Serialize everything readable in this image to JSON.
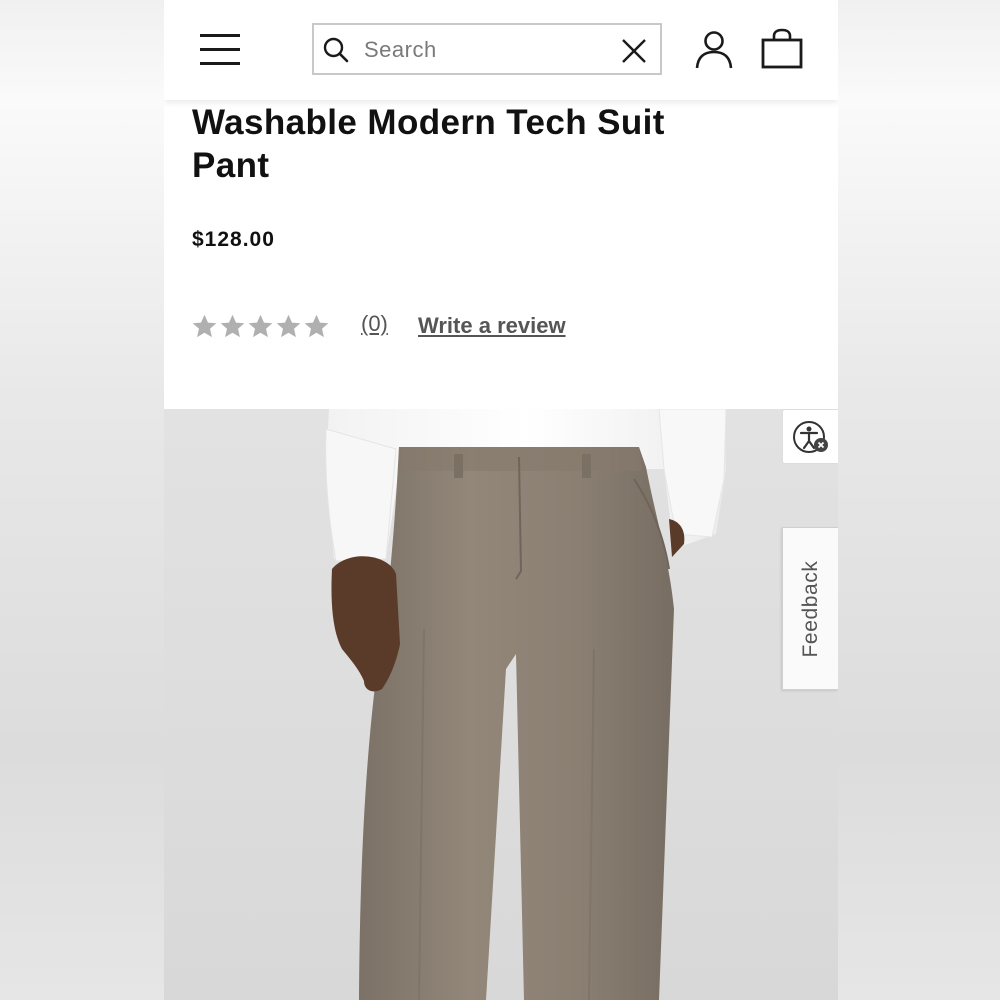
{
  "header": {
    "search": {
      "placeholder": "Search"
    }
  },
  "product": {
    "title": "Washable Modern Tech Suit Pant",
    "price": "$128.00",
    "rating": {
      "stars": 0,
      "max_stars": 5,
      "review_count": "(0)"
    },
    "write_review_label": "Write a review"
  },
  "side_tabs": {
    "feedback_label": "Feedback"
  },
  "icons": {
    "menu": "hamburger-menu-icon",
    "search": "search-icon",
    "clear": "close-icon",
    "account": "user-icon",
    "bag": "shopping-bag-icon",
    "accessibility": "accessibility-icon"
  },
  "colors": {
    "text": "#111111",
    "muted_text": "#555555",
    "star_empty": "#b0b0b0",
    "pants": "#8a7f73",
    "shirt": "#ffffff",
    "photo_background": "#dddddd"
  }
}
